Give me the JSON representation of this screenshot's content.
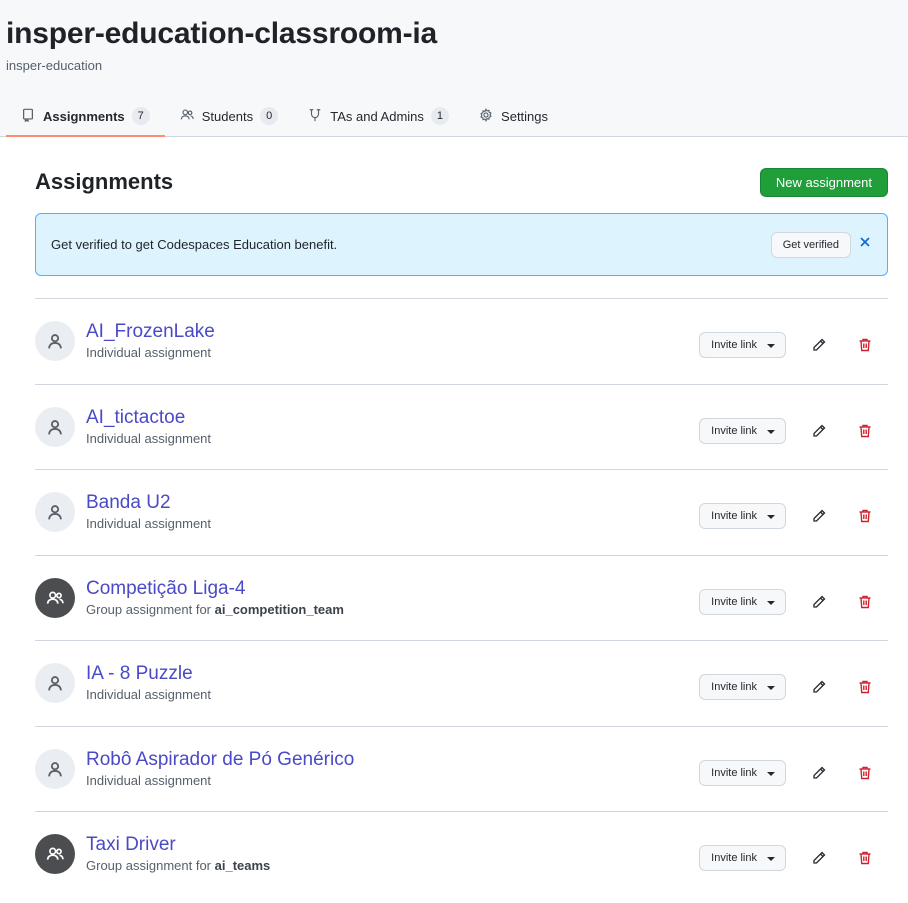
{
  "header": {
    "title": "insper-education-classroom-ia",
    "org": "insper-education"
  },
  "tabs": [
    {
      "label": "Assignments",
      "count": "7",
      "icon": "book-icon",
      "active": true
    },
    {
      "label": "Students",
      "count": "0",
      "icon": "people-icon"
    },
    {
      "label": "TAs and Admins",
      "count": "1",
      "icon": "mortarboard-icon"
    },
    {
      "label": "Settings",
      "icon": "gear-icon"
    }
  ],
  "main": {
    "title": "Assignments",
    "new_button": "New assignment"
  },
  "flash": {
    "message": "Get verified to get Codespaces Education benefit.",
    "button": "Get verified"
  },
  "colors": {
    "primary_button": "#1f9e3a",
    "link": "#4a49c7",
    "danger": "#cf222e",
    "flash_bg": "#ddf4ff",
    "tab_underline": "#fd8c73"
  },
  "invite_label": "Invite link",
  "assignments": [
    {
      "title": "AI_FrozenLake",
      "type": "Individual assignment",
      "group": false
    },
    {
      "title": "AI_tictactoe",
      "type": "Individual assignment",
      "group": false
    },
    {
      "title": "Banda U2",
      "type": "Individual assignment",
      "group": false
    },
    {
      "title": "Competição Liga-4",
      "type": "Group assignment for ",
      "team": "ai_competition_team",
      "group": true
    },
    {
      "title": "IA - 8 Puzzle",
      "type": "Individual assignment",
      "group": false
    },
    {
      "title": "Robô Aspirador de Pó Genérico",
      "type": "Individual assignment",
      "group": false
    },
    {
      "title": "Taxi Driver",
      "type": "Group assignment for ",
      "team": "ai_teams",
      "group": true
    }
  ]
}
